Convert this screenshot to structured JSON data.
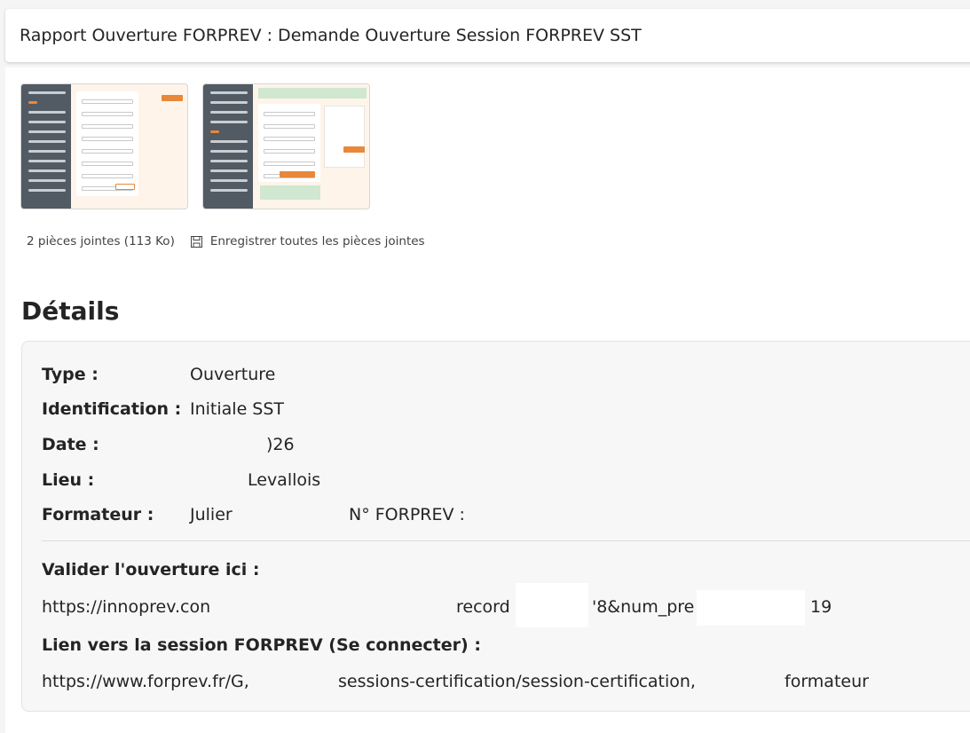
{
  "subject": "Rapport Ouverture FORPREV : Demande Ouverture Session FORPREV SST",
  "attachments": {
    "count_label": "2 pièces jointes (113 Ko)",
    "save_all_label": "Enregistrer toutes les pièces jointes"
  },
  "details": {
    "title": "Détails",
    "type_label": "Type :",
    "type_value": "Ouverture",
    "identification_label": "Identification :",
    "identification_value": "Initiale SST",
    "date_label": "Date :",
    "date_value": ")26",
    "lieu_label": "Lieu :",
    "lieu_value": "Levallois",
    "formateur_label": "Formateur :",
    "formateur_value": "Julier",
    "forprev_no": "N° FORPREV :",
    "validate_heading": "Valider l'ouverture ici :",
    "validate_link_part1": "https://innoprev.con",
    "validate_link_part2": "record",
    "validate_link_part3": "'8&num_pre",
    "validate_link_part4": "19",
    "session_heading": "Lien vers la session FORPREV (Se connecter) :",
    "session_link_part1": "https://www.forprev.fr/G,",
    "session_link_part2": "sessions-certification/session-certification,",
    "session_link_part3": "formateur"
  }
}
